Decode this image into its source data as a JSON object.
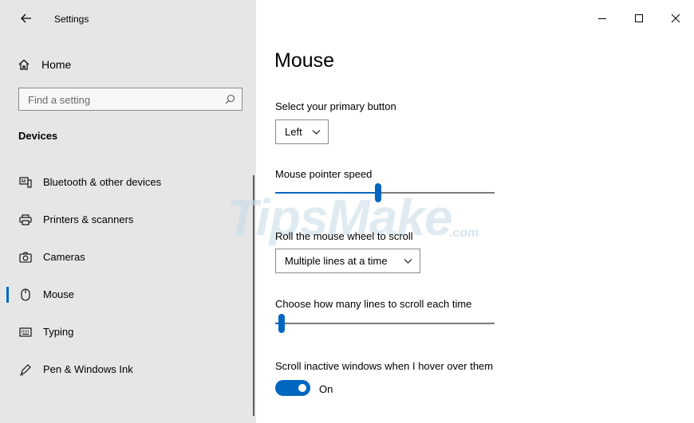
{
  "window": {
    "title": "Settings",
    "controls": {
      "minimize": "—",
      "maximize": "☐",
      "close": "✕"
    }
  },
  "sidebar": {
    "home_label": "Home",
    "search": {
      "placeholder": "Find a setting"
    },
    "section_title": "Devices",
    "items": [
      {
        "label": "Bluetooth & other devices",
        "icon": "bluetooth-devices-icon",
        "selected": false
      },
      {
        "label": "Printers & scanners",
        "icon": "printer-icon",
        "selected": false
      },
      {
        "label": "Cameras",
        "icon": "camera-icon",
        "selected": false
      },
      {
        "label": "Mouse",
        "icon": "mouse-icon",
        "selected": true
      },
      {
        "label": "Typing",
        "icon": "keyboard-icon",
        "selected": false
      },
      {
        "label": "Pen & Windows Ink",
        "icon": "pen-icon",
        "selected": false
      }
    ]
  },
  "main": {
    "page_title": "Mouse",
    "primary_button": {
      "label": "Select your primary button",
      "value": "Left"
    },
    "pointer_speed": {
      "label": "Mouse pointer speed",
      "fraction": 0.47
    },
    "wheel_scroll": {
      "label": "Roll the mouse wheel to scroll",
      "value": "Multiple lines at a time"
    },
    "lines_to_scroll": {
      "label": "Choose how many lines to scroll each time",
      "fraction": 0.03
    },
    "scroll_inactive": {
      "label": "Scroll inactive windows when I hover over them",
      "state": "On"
    }
  },
  "watermark": {
    "text": "TipsMake",
    "sub": ".com"
  },
  "colors": {
    "accent": "#0067c0",
    "sidebar_bg": "#e6e6e6"
  }
}
